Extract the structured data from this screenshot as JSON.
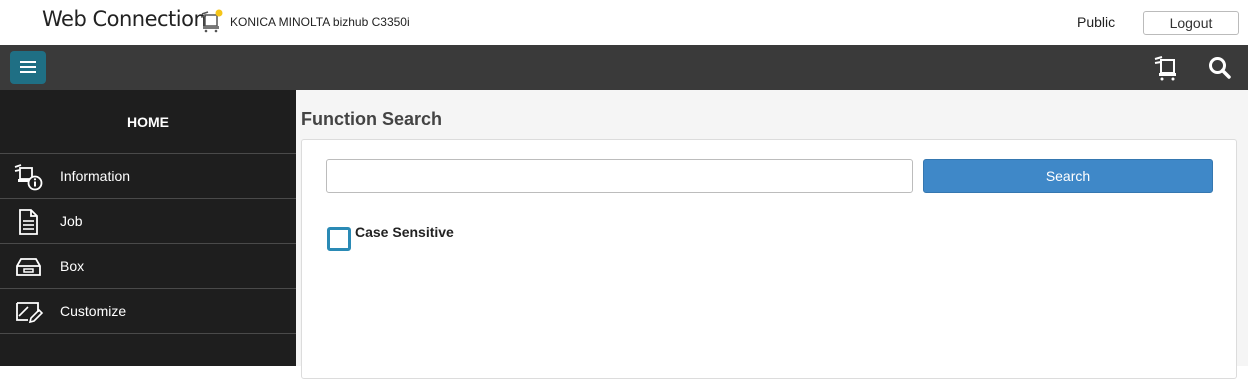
{
  "header": {
    "brand": "Web Connection",
    "model": "KONICA MINOLTA bizhub C3350i",
    "user": "Public",
    "logout_label": "Logout"
  },
  "toolbar": {
    "menu_icon": "hamburger-icon",
    "device_icon": "device-status-icon",
    "search_icon": "search-icon"
  },
  "sidebar": {
    "home_label": "HOME",
    "items": [
      {
        "label": "Information",
        "icon": "information-icon"
      },
      {
        "label": "Job",
        "icon": "job-document-icon"
      },
      {
        "label": "Box",
        "icon": "box-tray-icon"
      },
      {
        "label": "Customize",
        "icon": "customize-icon"
      }
    ]
  },
  "main": {
    "title": "Function Search",
    "search_value": "",
    "search_button": "Search",
    "case_sensitive_label": "Case Sensitive",
    "case_sensitive_checked": false
  },
  "colors": {
    "toolbar": "#3a3a3a",
    "sidebar": "#1e1e1e",
    "menu_button": "#1f6f84",
    "search_button": "#3f88c8",
    "checkbox_border": "#2a8ab5"
  }
}
